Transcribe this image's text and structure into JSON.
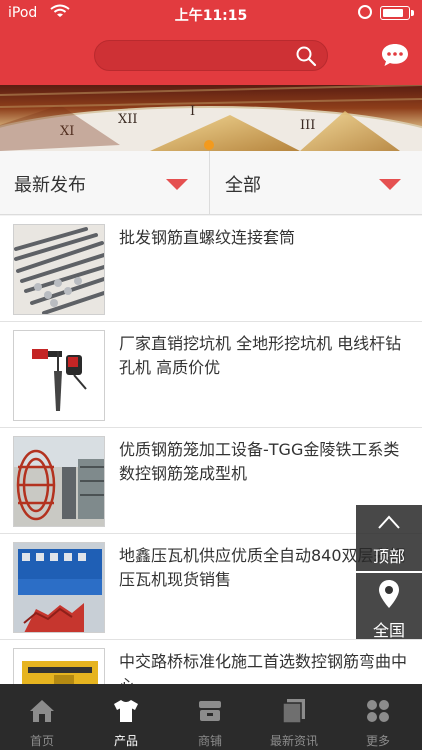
{
  "status_bar": {
    "carrier": "iPod",
    "time": "上午11:15"
  },
  "search": {
    "placeholder": ""
  },
  "filters": {
    "sort_label": "最新发布",
    "category_label": "全部"
  },
  "products": [
    {
      "title": "批发钢筋直螺纹连接套筒"
    },
    {
      "title": "厂家直销挖坑机 全地形挖坑机 电线杆钻孔机 高质价优"
    },
    {
      "title": "优质钢筋笼加工设备-TGG金陵铁工系类数控钢筋笼成型机"
    },
    {
      "title": "地鑫压瓦机供应优质全自动840双层彩钢压瓦机现货销售"
    },
    {
      "title": "中交路桥标准化施工首选数控钢筋弯曲中心"
    }
  ],
  "side_buttons": {
    "top_label": "顶部",
    "location_label": "全国"
  },
  "tabbar": [
    {
      "label": "首页",
      "icon": "home-icon",
      "active": false
    },
    {
      "label": "产品",
      "icon": "shirt-icon",
      "active": true
    },
    {
      "label": "商铺",
      "icon": "shop-icon",
      "active": false
    },
    {
      "label": "最新资讯",
      "icon": "news-icon",
      "active": false
    },
    {
      "label": "更多",
      "icon": "more-icon",
      "active": false
    }
  ],
  "colors": {
    "brand": "#e23b3f",
    "caret": "#e55050",
    "tabbar": "#2b2b2b"
  }
}
